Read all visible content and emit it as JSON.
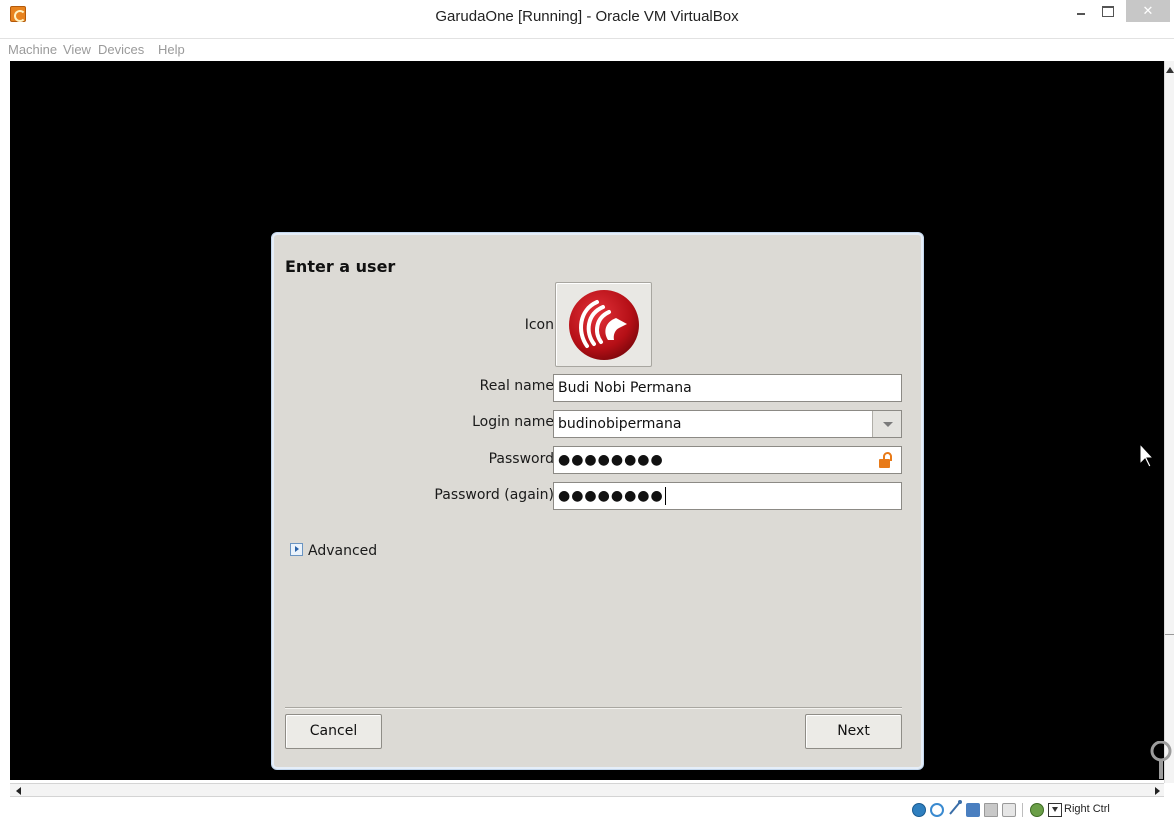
{
  "window": {
    "title": "GarudaOne [Running] - Oracle VM VirtualBox",
    "app_icon": "virtualbox-icon",
    "close_glyph": "✕"
  },
  "menubar": {
    "items": [
      {
        "label": "Machine"
      },
      {
        "label": "View"
      },
      {
        "label": "Devices"
      },
      {
        "label": "Help"
      }
    ]
  },
  "dialog": {
    "heading": "Enter a user",
    "icon_label": "Icon",
    "real_name_label": "Real name",
    "real_name_value": "Budi Nobi Permana",
    "login_name_label": "Login name",
    "login_name_value": "budinobipermana",
    "password_label": "Password",
    "password_value": "●●●●●●●●",
    "password_again_label": "Password (again)",
    "password_again_value": "●●●●●●●●",
    "advanced_label": "Advanced",
    "cancel_label": "Cancel",
    "next_label": "Next"
  },
  "statusbar": {
    "host_key": "Right Ctrl"
  },
  "colors": {
    "dialog_bg": "#dcdad5",
    "vm_screen": "#000000",
    "logo_red": "#c1141a",
    "lock_orange": "#e87a18"
  }
}
